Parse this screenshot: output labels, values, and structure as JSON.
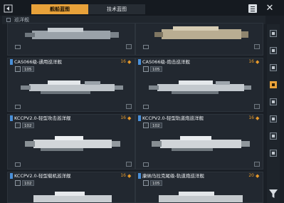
{
  "header": {
    "tabs": [
      {
        "label": "舰船蓝图",
        "active": true
      },
      {
        "label": "技术蓝图",
        "active": false
      }
    ]
  },
  "breadcrumb": {
    "label": "巡洋舰"
  },
  "cards": [
    {
      "name": "",
      "power": "",
      "badge": "",
      "meta": "",
      "slots": "",
      "ship": "cruiser-a"
    },
    {
      "name": "",
      "power": "",
      "badge": "",
      "meta": "",
      "slots": "",
      "ship": "cruiser-b"
    },
    {
      "name": "CAS066级-通用巡洋舰",
      "power": "16",
      "badge": "105",
      "meta": "",
      "slots": "",
      "ship": "cruiser-c"
    },
    {
      "name": "CAS066级-炮击巡洋舰",
      "power": "16",
      "badge": "105",
      "meta": "",
      "slots": "",
      "ship": "cruiser-d"
    },
    {
      "name": "KCCPV2.0-轻型攻击巡洋舰",
      "power": "16",
      "badge": "102",
      "meta": "",
      "slots": "",
      "ship": "cruiser-e"
    },
    {
      "name": "KCCPV2.0-轻型轨道炮巡洋舰",
      "power": "16",
      "badge": "102",
      "meta": "",
      "slots": "",
      "ship": "cruiser-f"
    },
    {
      "name": "KCCPV2.0-轻型载机巡洋舰",
      "power": "16",
      "badge": "102",
      "meta": "",
      "slots": "",
      "ship": "cruiser-g"
    },
    {
      "name": "康纳马拉克尾级-轨道炮巡洋舰",
      "power": "20",
      "badge": "105",
      "meta": "",
      "slots": "",
      "ship": "cruiser-h"
    }
  ],
  "rail": {
    "items": [
      "rail-1",
      "rail-2",
      "rail-3",
      "rail-4",
      "rail-5",
      "rail-6",
      "rail-7",
      "rail-8"
    ],
    "active_index": 3
  },
  "colors": {
    "accent": "#e8a23a",
    "tier": "#4a90d9",
    "bg": "#1a1f26"
  }
}
